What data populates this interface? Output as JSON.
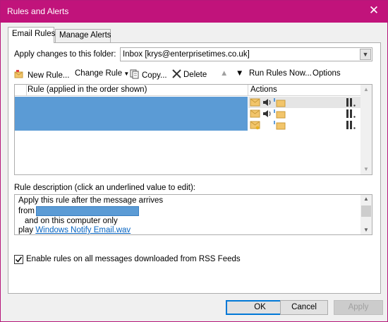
{
  "window": {
    "title": "Rules and Alerts"
  },
  "tabs": [
    {
      "label": "Email Rules",
      "active": true
    },
    {
      "label": "Manage Alerts",
      "active": false
    }
  ],
  "folder": {
    "label": "Apply changes to this folder:",
    "value": "Inbox [krys@enterprisetimes.co.uk]"
  },
  "toolbar": {
    "new_rule": "New Rule...",
    "change_rule": "Change Rule",
    "copy": "Copy...",
    "delete": "Delete",
    "run_rules": "Run Rules Now...",
    "options": "Options"
  },
  "rules_table": {
    "columns": [
      "Rule (applied in the order shown)",
      "Actions"
    ],
    "row_count": 3
  },
  "description": {
    "label": "Rule description (click an underlined value to edit):",
    "line1": "Apply this rule after the message arrives",
    "line2_prefix": "from",
    "line3": "and on this computer only",
    "line4_prefix": "play",
    "line4_link": "Windows Notify Email.wav"
  },
  "rss_checkbox": {
    "label": "Enable rules on all messages downloaded from RSS Feeds",
    "checked": true
  },
  "buttons": {
    "ok": "OK",
    "cancel": "Cancel",
    "apply": "Apply"
  },
  "colors": {
    "titlebar": "#c1137b",
    "selection": "#5b9bd5",
    "link": "#0563c1"
  }
}
